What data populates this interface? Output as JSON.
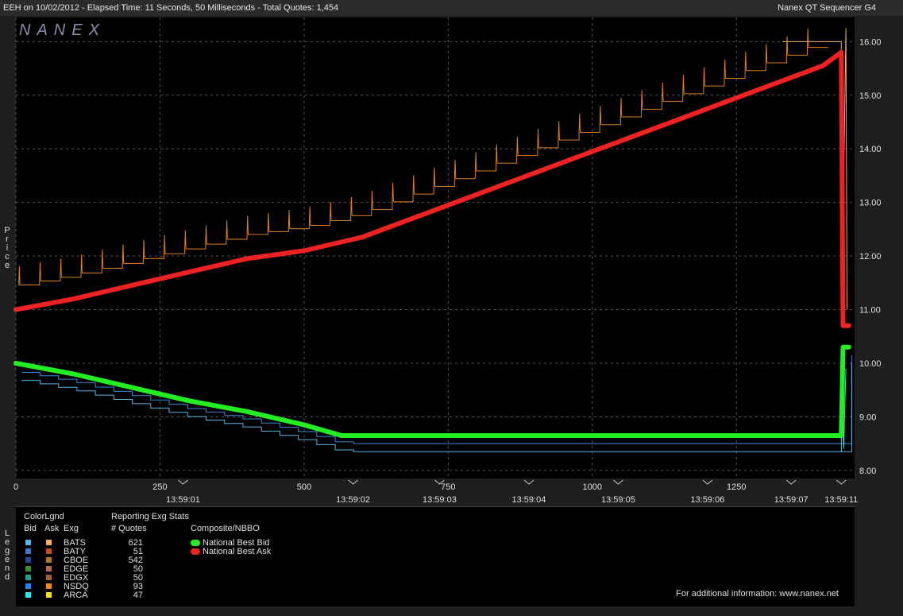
{
  "header": {
    "title_left": "EEH on 10/02/2012  -  Elapsed Time: 11 Seconds, 50 Milliseconds  -  Total Quotes: 1,454",
    "title_right": "Nanex QT Sequencer G4"
  },
  "watermark": "NANEX",
  "y_axis_label": "P\nr\ni\nc\ne",
  "legend_vertical_label": "L\ne\ng\ne\nn\nd",
  "legend": {
    "colorlgnd": "ColorLgnd",
    "reporting": "Reporting Exg Stats",
    "col_bid": "Bid",
    "col_ask": "Ask",
    "col_exg": "Exg",
    "col_quotes": "# Quotes",
    "composite_title": "Composite/NBBO",
    "exchanges": [
      {
        "name": "BATS",
        "quotes": "621",
        "bid_color": "#5ab4e6",
        "ask_color": "#f0b060"
      },
      {
        "name": "BATY",
        "quotes": "51",
        "bid_color": "#3a78c0",
        "ask_color": "#c0501e"
      },
      {
        "name": "CBOE",
        "quotes": "542",
        "bid_color": "#1e4a96",
        "ask_color": "#b07820"
      },
      {
        "name": "EDGE",
        "quotes": "50",
        "bid_color": "#3c8c3c",
        "ask_color": "#b06a4a"
      },
      {
        "name": "EDGX",
        "quotes": "50",
        "bid_color": "#2aa08c",
        "ask_color": "#a06040"
      },
      {
        "name": "NSDQ",
        "quotes": "93",
        "bid_color": "#2288ee",
        "ask_color": "#f08c1e"
      },
      {
        "name": "ARCA",
        "quotes": "47",
        "bid_color": "#28e8f0",
        "ask_color": "#f0e020"
      }
    ],
    "composite": [
      {
        "label": "National Best Bid",
        "color": "#22ee22"
      },
      {
        "label": "National Best Ask",
        "color": "#ee2222"
      }
    ],
    "info": "For additional information: www.nanex.net"
  },
  "chart_data": {
    "type": "line",
    "x_label": "",
    "y_label": "Price",
    "xlim": [
      0,
      1455
    ],
    "ylim": [
      7.85,
      16.45
    ],
    "x_ticks": [
      0,
      250,
      500,
      750,
      1000,
      1250
    ],
    "y_ticks": [
      8.0,
      9.0,
      10.0,
      11.0,
      12.0,
      13.0,
      14.0,
      15.0,
      16.0
    ],
    "y_tick_labels": [
      "8.00",
      "9.00",
      "10.00",
      "11.00",
      "12.00",
      "13.00",
      "14.00",
      "15.00",
      "16.00"
    ],
    "time_ticks": [
      {
        "x": 290,
        "label": "13:59:01"
      },
      {
        "x": 585,
        "label": "13:59:02"
      },
      {
        "x": 735,
        "label": "13:59:03"
      },
      {
        "x": 890,
        "label": "13:59:04"
      },
      {
        "x": 1045,
        "label": "13:59:05"
      },
      {
        "x": 1200,
        "label": "13:59:06"
      },
      {
        "x": 1345,
        "label": "13:59:07"
      },
      {
        "x": 1432,
        "label": "13:59:11"
      }
    ],
    "series": [
      {
        "name": "National Best Ask",
        "color": "#ee2222",
        "x": [
          0,
          100,
          200,
          300,
          400,
          500,
          600,
          700,
          800,
          900,
          1000,
          1100,
          1200,
          1300,
          1400,
          1432,
          1435,
          1445
        ],
        "y": [
          11.0,
          11.2,
          11.45,
          11.7,
          11.95,
          12.1,
          12.35,
          12.75,
          13.15,
          13.55,
          13.95,
          14.35,
          14.75,
          15.15,
          15.55,
          15.8,
          10.7,
          10.7
        ]
      },
      {
        "name": "National Best Bid",
        "color": "#22ee22",
        "x": [
          0,
          100,
          200,
          300,
          400,
          500,
          565,
          600,
          800,
          1000,
          1200,
          1432,
          1435,
          1445
        ],
        "y": [
          10.0,
          9.8,
          9.55,
          9.3,
          9.1,
          8.85,
          8.65,
          8.65,
          8.65,
          8.65,
          8.65,
          8.65,
          10.3,
          10.3
        ]
      }
    ]
  }
}
